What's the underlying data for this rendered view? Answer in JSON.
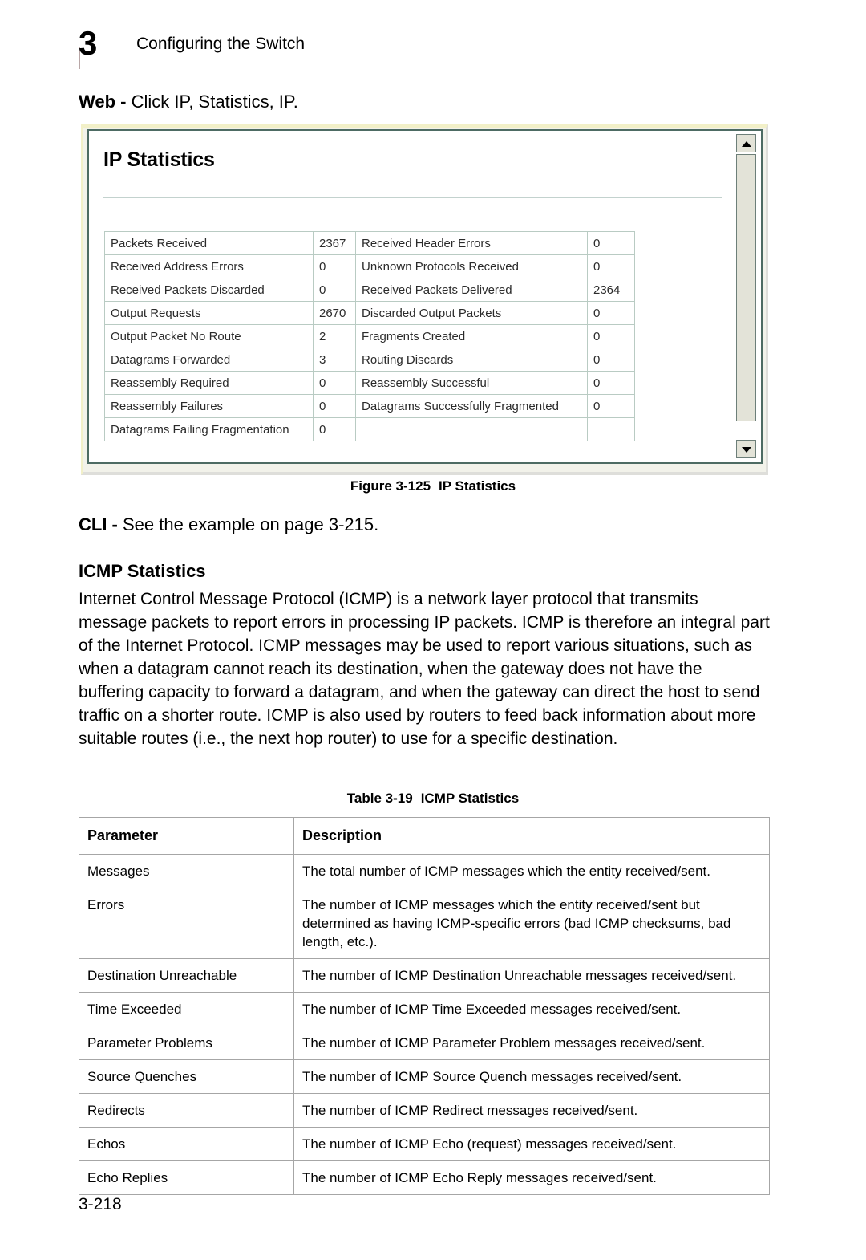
{
  "header": {
    "chapter_number": "3",
    "chapter_title": "Configuring the Switch"
  },
  "web_instruction": {
    "label": "Web -",
    "text": " Click IP, Statistics, IP."
  },
  "figure": {
    "panel_title": "IP Statistics",
    "caption_number": "Figure 3-125",
    "caption_title": "IP Statistics",
    "scrollbar": {
      "up_arrow": "scroll-up-arrow",
      "down_arrow": "scroll-down-arrow"
    },
    "stats": [
      {
        "label_a": "Packets Received",
        "value_a": "2367",
        "label_b": "Received Header Errors",
        "value_b": "0"
      },
      {
        "label_a": "Received Address Errors",
        "value_a": "0",
        "label_b": "Unknown Protocols Received",
        "value_b": "0"
      },
      {
        "label_a": "Received Packets Discarded",
        "value_a": "0",
        "label_b": "Received Packets Delivered",
        "value_b": "2364"
      },
      {
        "label_a": "Output Requests",
        "value_a": "2670",
        "label_b": "Discarded Output Packets",
        "value_b": "0"
      },
      {
        "label_a": "Output Packet No Route",
        "value_a": "2",
        "label_b": "Fragments Created",
        "value_b": "0"
      },
      {
        "label_a": "Datagrams Forwarded",
        "value_a": "3",
        "label_b": "Routing Discards",
        "value_b": "0"
      },
      {
        "label_a": "Reassembly Required",
        "value_a": "0",
        "label_b": "Reassembly Successful",
        "value_b": "0"
      },
      {
        "label_a": "Reassembly Failures",
        "value_a": "0",
        "label_b": "Datagrams Successfully Fragmented",
        "value_b": "0"
      },
      {
        "label_a": "Datagrams Failing Fragmentation",
        "value_a": "0",
        "label_b": "",
        "value_b": ""
      }
    ]
  },
  "cli_instruction": {
    "label": "CLI -",
    "text": " See the example on page 3-215."
  },
  "icmp_section": {
    "heading": "ICMP Statistics",
    "paragraph": "Internet Control Message Protocol (ICMP) is a network layer protocol that transmits message packets to report errors in processing IP packets. ICMP is therefore an integral part of the Internet Protocol. ICMP messages may be used to report various situations, such as when a datagram cannot reach its destination, when the gateway does not have the buffering capacity to forward a datagram, and when the gateway can direct the host to send traffic on a shorter route. ICMP is also used by routers to feed back information about more suitable routes (i.e., the next hop router) to use for a specific destination."
  },
  "table": {
    "caption_number": "Table 3-19",
    "caption_title": "ICMP Statistics",
    "columns": [
      "Parameter",
      "Description"
    ],
    "rows": [
      {
        "parameter": "Messages",
        "description": "The total number of ICMP messages which the entity received/sent."
      },
      {
        "parameter": "Errors",
        "description": "The number of ICMP messages which the entity received/sent but determined as having ICMP-specific errors (bad ICMP checksums, bad length, etc.)."
      },
      {
        "parameter": "Destination Unreachable",
        "description": "The number of ICMP Destination Unreachable messages received/sent."
      },
      {
        "parameter": "Time Exceeded",
        "description": "The number of ICMP Time Exceeded messages received/sent."
      },
      {
        "parameter": "Parameter Problems",
        "description": "The number of ICMP Parameter Problem messages received/sent."
      },
      {
        "parameter": "Source Quenches",
        "description": "The number of ICMP Source Quench messages received/sent."
      },
      {
        "parameter": "Redirects",
        "description": "The number of ICMP Redirect messages received/sent."
      },
      {
        "parameter": "Echos",
        "description": "The number of ICMP Echo (request) messages received/sent."
      },
      {
        "parameter": "Echo Replies",
        "description": "The number of ICMP Echo Reply messages received/sent."
      }
    ]
  },
  "footer": {
    "page_number": "3-218"
  }
}
